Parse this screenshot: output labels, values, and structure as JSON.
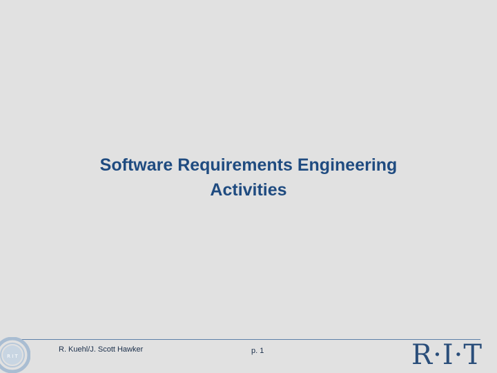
{
  "slide": {
    "title_line_1": "Software Requirements Engineering",
    "title_line_2": "Activities"
  },
  "footer": {
    "author": "R. Kuehl/J. Scott Hawker",
    "page": "p. 1"
  },
  "logo": {
    "text": "R·I·T",
    "seal_text": "R I T"
  },
  "colors": {
    "background": "#e1e1e1",
    "title": "#1f4b80",
    "rule": "#5d7fa8",
    "logo": "#2a4e7a"
  }
}
